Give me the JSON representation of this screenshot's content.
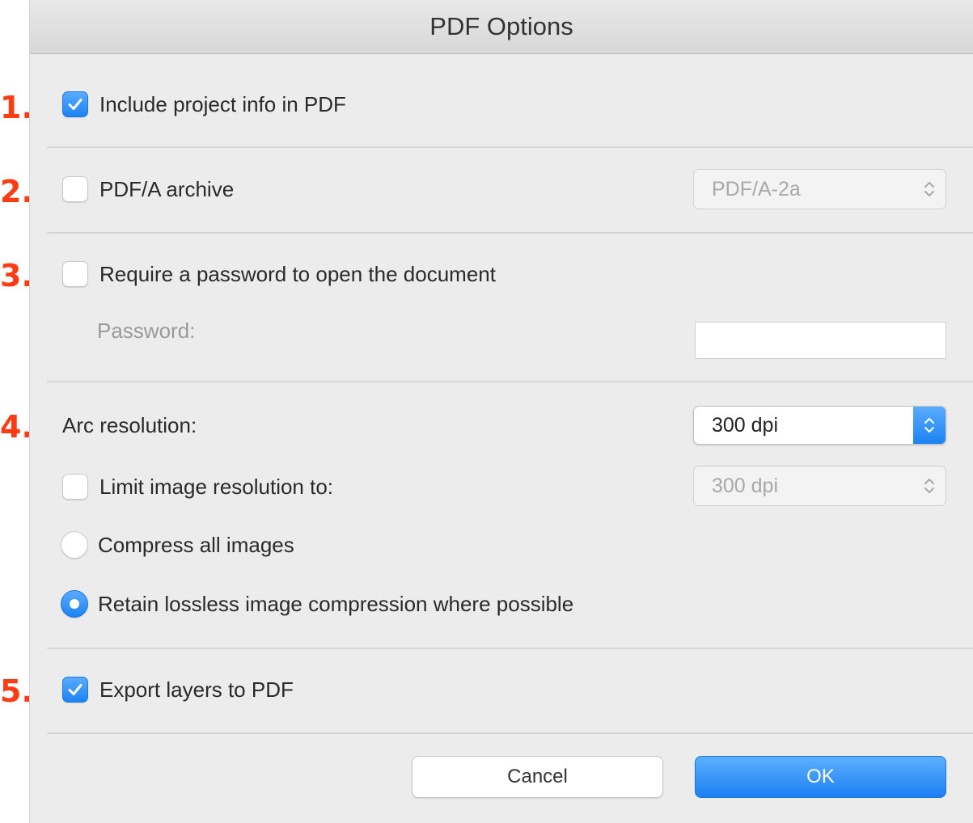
{
  "dialog": {
    "title": "PDF Options"
  },
  "steps": [
    "1.",
    "2.",
    "3.",
    "4.",
    "5."
  ],
  "project_info": {
    "label": "Include project info in PDF",
    "checked": true
  },
  "pdfa": {
    "label": "PDF/A archive",
    "checked": false,
    "select_value": "PDF/A-2a"
  },
  "password": {
    "label": "Require a password to open the document",
    "checked": false,
    "field_label": "Password:",
    "value": ""
  },
  "resolution": {
    "arc_label": "Arc resolution:",
    "arc_value": "300 dpi",
    "limit_label": "Limit image resolution to:",
    "limit_checked": false,
    "limit_value": "300 dpi"
  },
  "compression": {
    "option_all": "Compress all images",
    "option_lossless": "Retain lossless image compression where possible",
    "selected": "lossless"
  },
  "layers": {
    "label": "Export layers to PDF",
    "checked": true
  },
  "buttons": {
    "cancel": "Cancel",
    "ok": "OK"
  },
  "colors": {
    "accent": "#1c83f3",
    "step_marker": "#ff3b14",
    "background": "#ececec"
  }
}
